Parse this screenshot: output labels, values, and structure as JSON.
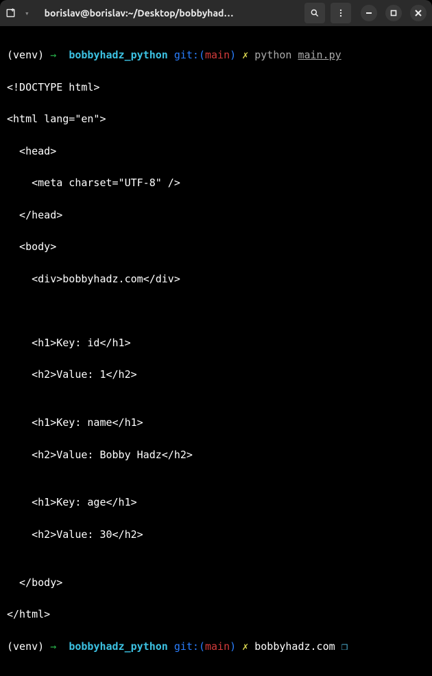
{
  "titlebar": {
    "title": "borislav@borislav:~/Desktop/bobbyhadz_..."
  },
  "prompt1": {
    "venv": "(venv)",
    "arrow": "→",
    "folder": "bobbyhadz_python",
    "git_label": "git:",
    "git_paren_open": "(",
    "git_branch": "main",
    "git_paren_close": ")",
    "lightning": "✗",
    "cmd": "python",
    "cmd_arg": "main.py"
  },
  "output": {
    "l0": "<!DOCTYPE html>",
    "l1": "<html lang=\"en\">",
    "l2": "  <head>",
    "l3": "    <meta charset=\"UTF-8\" />",
    "l4": "  </head>",
    "l5": "  <body>",
    "l6": "    <div>bobbyhadz.com</div>",
    "l7": "",
    "l8": "",
    "l9": "    <h1>Key: id</h1>",
    "l10": "    <h2>Value: 1</h2>",
    "l11": "",
    "l12": "    <h1>Key: name</h1>",
    "l13": "    <h2>Value: Bobby Hadz</h2>",
    "l14": "",
    "l15": "    <h1>Key: age</h1>",
    "l16": "    <h2>Value: 30</h2>",
    "l17": "",
    "l18": "  </body>",
    "l19": "</html>"
  },
  "prompt2": {
    "venv": "(venv)",
    "arrow": "→",
    "folder": "bobbyhadz_python",
    "git_label": "git:",
    "git_paren_open": "(",
    "git_branch": "main",
    "git_paren_close": ")",
    "lightning": "✗",
    "site": "bobbyhadz.com",
    "cube": "❒"
  }
}
